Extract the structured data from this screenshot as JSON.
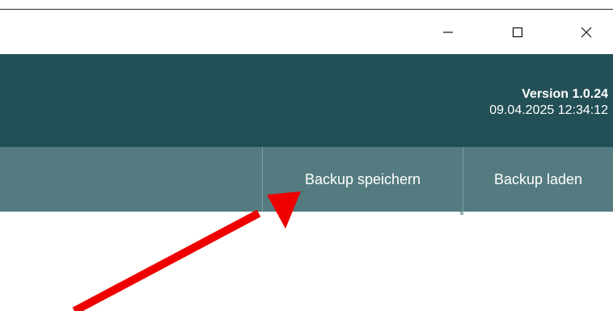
{
  "window_controls": {
    "minimize": "—",
    "maximize": "☐",
    "close": "✕"
  },
  "header": {
    "version_label": "Version 1.0.24",
    "timestamp": "09.04.2025 12:34:12"
  },
  "toolbar": {
    "save_backup_label": "Backup speichern",
    "load_backup_label": "Backup laden"
  },
  "annotation": {
    "arrow_color": "#ee0000",
    "arrow_icon": "arrow-icon"
  },
  "colors": {
    "header_bg": "#234f56",
    "toolbar_bg": "#547c80"
  }
}
